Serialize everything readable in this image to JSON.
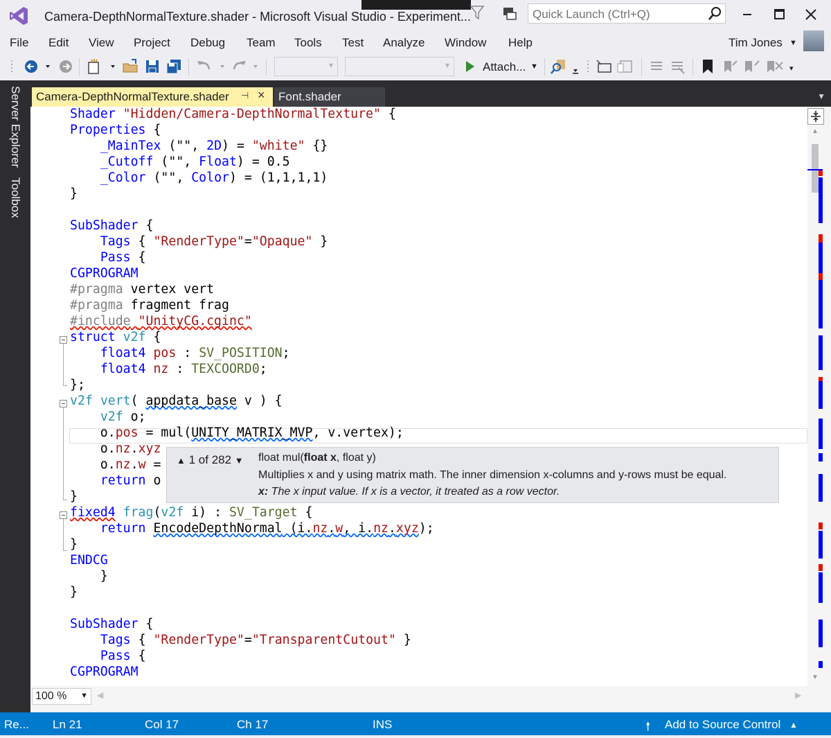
{
  "window": {
    "title": "Camera-DepthNormalTexture.shader - Microsoft Visual Studio  - Experiment...",
    "quick_launch_placeholder": "Quick Launch (Ctrl+Q)"
  },
  "menu": [
    "File",
    "Edit",
    "View",
    "Project",
    "Debug",
    "Team",
    "Tools",
    "Test",
    "Analyze",
    "Window",
    "Help"
  ],
  "user": {
    "name": "Tim Jones"
  },
  "toolbar": {
    "attach_label": "Attach..."
  },
  "sidebar": {
    "tabs": [
      "Server Explorer",
      "Toolbox"
    ]
  },
  "tabs": [
    {
      "label": "Camera-DepthNormalTexture.shader",
      "active": true
    },
    {
      "label": "Font.shader",
      "active": false
    }
  ],
  "code": {
    "l1": [
      "Shader",
      " ",
      "\"Hidden/Camera-DepthNormalTexture\"",
      " {"
    ],
    "l2": [
      "Properties",
      " {"
    ],
    "l3": [
      "    ",
      "_MainTex",
      " (\"\", ",
      "2D",
      ") = ",
      "\"white\"",
      " {}"
    ],
    "l4": [
      "    ",
      "_Cutoff",
      " (\"\", ",
      "Float",
      ") = 0.5"
    ],
    "l5": [
      "    ",
      "_Color",
      " (\"\", ",
      "Color",
      ") = (1,1,1,1)"
    ],
    "l6": [
      "}"
    ],
    "l8": [
      "SubShader",
      " {"
    ],
    "l9": [
      "    ",
      "Tags",
      " { ",
      "\"RenderType\"",
      "=",
      "\"Opaque\"",
      " }"
    ],
    "l10": [
      "    ",
      "Pass",
      " {"
    ],
    "l11": [
      "CGPROGRAM"
    ],
    "l12": [
      "#pragma",
      " vertex vert"
    ],
    "l13": [
      "#pragma",
      " fragment frag"
    ],
    "l14": [
      "#include",
      " ",
      "\"UnityCG.cginc\""
    ],
    "l15": [
      "struct",
      " ",
      "v2f",
      " {"
    ],
    "l16": [
      "    ",
      "float4",
      " ",
      "pos",
      " : ",
      "SV_POSITION",
      ";"
    ],
    "l17": [
      "    ",
      "float4",
      " ",
      "nz",
      " : ",
      "TEXCOORD0",
      ";"
    ],
    "l18": [
      "};"
    ],
    "l19": [
      "v2f",
      " ",
      "vert",
      "( ",
      "appdata_base",
      " v ) {"
    ],
    "l20": [
      "    ",
      "v2f",
      " o;"
    ],
    "l21": [
      "    o.",
      "pos",
      " = ",
      "mul",
      "(",
      "UNITY_MATRIX_MVP",
      ", v.vertex);"
    ],
    "l22": [
      "    o.",
      "nz",
      ".",
      "xyz"
    ],
    "l23": [
      "    o.",
      "nz",
      ".",
      "w",
      " ="
    ],
    "l24": [
      "    ",
      "return",
      " o"
    ],
    "l25": [
      "}"
    ],
    "l26": [
      "fixed4",
      " ",
      "frag",
      "(",
      "v2f",
      " i) : ",
      "SV_Target",
      " {"
    ],
    "l27": [
      "    ",
      "return",
      " ",
      "EncodeDepthNormal",
      " (i.",
      "nz",
      ".",
      "w",
      ", i.",
      "nz",
      ".",
      "xyz",
      ");"
    ],
    "l28": [
      "}"
    ],
    "l29": [
      "ENDCG"
    ],
    "l30": [
      "    }"
    ],
    "l31": [
      "}"
    ],
    "l33": [
      "SubShader",
      " {"
    ],
    "l34": [
      "    ",
      "Tags",
      " { ",
      "\"RenderType\"",
      "=",
      "\"TransparentCutout\"",
      " }"
    ],
    "l35": [
      "    ",
      "Pass",
      " {"
    ],
    "l36": [
      "CGPROGRAM"
    ]
  },
  "tooltip": {
    "overload": "1 of 282",
    "signature_prefix": "float mul(",
    "signature_bold": "float x",
    "signature_suffix": ", float y)",
    "description": "Multiplies x and y using matrix math. The inner dimension x-columns and y-rows must be equal.",
    "param_name": "x:",
    "param_desc": " The x input value. If x is a vector, it treated as a row vector."
  },
  "zoom": "100 %",
  "status": {
    "ready": "Re...",
    "line": "Ln 21",
    "col": "Col 17",
    "ch": "Ch 17",
    "mode": "INS",
    "source_control": "Add to Source Control"
  },
  "colors": {
    "statusbar": "#007acc",
    "active_tab": "#fff1a8",
    "keyword": "#0000ff",
    "string": "#a31515",
    "type": "#2b91af"
  }
}
